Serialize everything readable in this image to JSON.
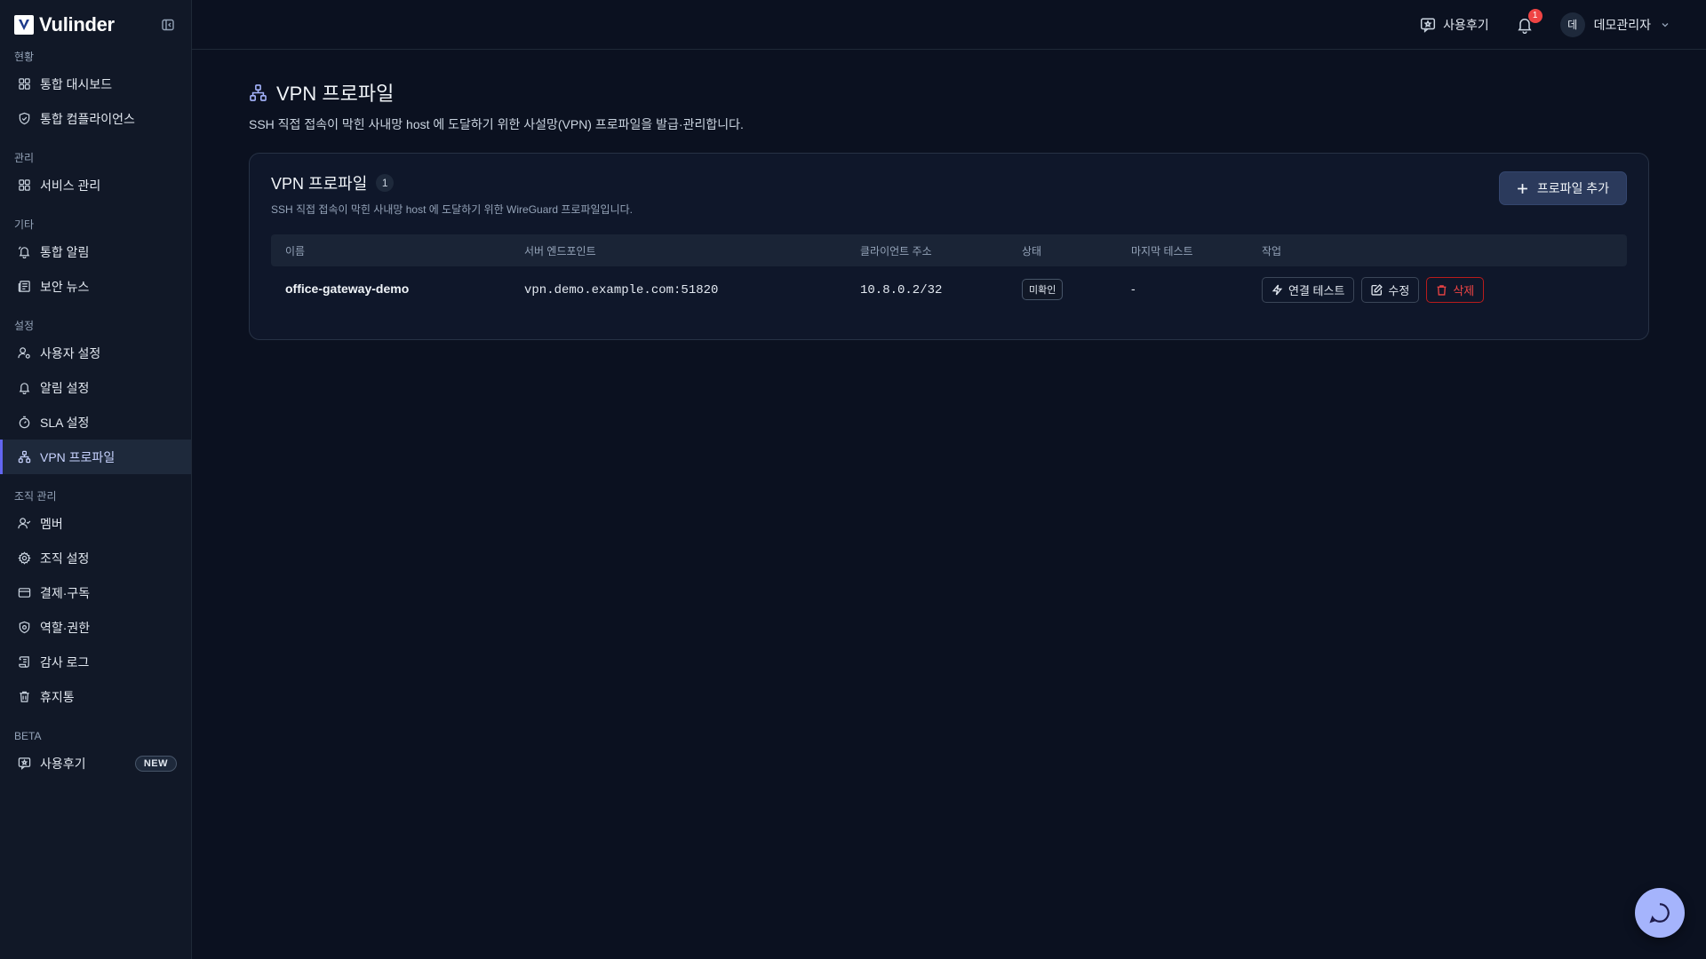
{
  "brand": {
    "name": "Vulinder",
    "logo_letter": "V"
  },
  "sidebar": {
    "sections": [
      {
        "label": "현황",
        "items": [
          {
            "label": "통합 대시보드",
            "icon": "grid-icon"
          },
          {
            "label": "통합 컴플라이언스",
            "icon": "shield-check-icon"
          }
        ]
      },
      {
        "label": "관리",
        "items": [
          {
            "label": "서비스 관리",
            "icon": "grid-icon"
          }
        ]
      },
      {
        "label": "기타",
        "items": [
          {
            "label": "통합 알림",
            "icon": "bell-ring-icon"
          },
          {
            "label": "보안 뉴스",
            "icon": "newspaper-icon"
          }
        ]
      },
      {
        "label": "설정",
        "items": [
          {
            "label": "사용자 설정",
            "icon": "user-cog-icon"
          },
          {
            "label": "알림 설정",
            "icon": "bell-icon"
          },
          {
            "label": "SLA 설정",
            "icon": "timer-icon"
          },
          {
            "label": "VPN 프로파일",
            "icon": "network-icon",
            "active": true
          }
        ]
      },
      {
        "label": "조직 관리",
        "items": [
          {
            "label": "멤버",
            "icon": "user-check-icon"
          },
          {
            "label": "조직 설정",
            "icon": "gear-icon"
          },
          {
            "label": "결제·구독",
            "icon": "credit-card-icon"
          },
          {
            "label": "역할·권한",
            "icon": "shield-gear-icon"
          },
          {
            "label": "감사 로그",
            "icon": "scroll-icon"
          },
          {
            "label": "휴지통",
            "icon": "trash-icon"
          }
        ]
      },
      {
        "label": "BETA",
        "items": [
          {
            "label": "사용후기",
            "icon": "message-square-icon",
            "badge": "NEW"
          }
        ]
      }
    ]
  },
  "topbar": {
    "review_label": "사용후기",
    "notification_count": "1",
    "user_initial": "데",
    "user_name": "데모관리자"
  },
  "page": {
    "title": "VPN 프로파일",
    "description": "SSH 직접 접속이 막힌 사내망 host 에 도달하기 위한 사설망(VPN) 프로파일을 발급·관리합니다."
  },
  "card": {
    "title": "VPN 프로파일",
    "count": "1",
    "description": "SSH 직접 접속이 막힌 사내망 host 에 도달하기 위한 WireGuard 프로파일입니다.",
    "add_button": "프로파일 추가"
  },
  "table": {
    "columns": [
      "이름",
      "서버 엔드포인트",
      "클라이언트 주소",
      "상태",
      "마지막 테스트",
      "작업"
    ],
    "rows": [
      {
        "name": "office-gateway-demo",
        "endpoint": "vpn.demo.example.com:51820",
        "client_address": "10.8.0.2/32",
        "status": "미확인",
        "last_test": "-",
        "actions": {
          "test": "연결 테스트",
          "edit": "수정",
          "delete": "삭제"
        }
      }
    ]
  },
  "colors": {
    "background": "#0b1120",
    "sidebar": "#111827",
    "accent": "#6366f1",
    "danger": "#ef4444",
    "chat_fab": "#a5b4fc"
  }
}
